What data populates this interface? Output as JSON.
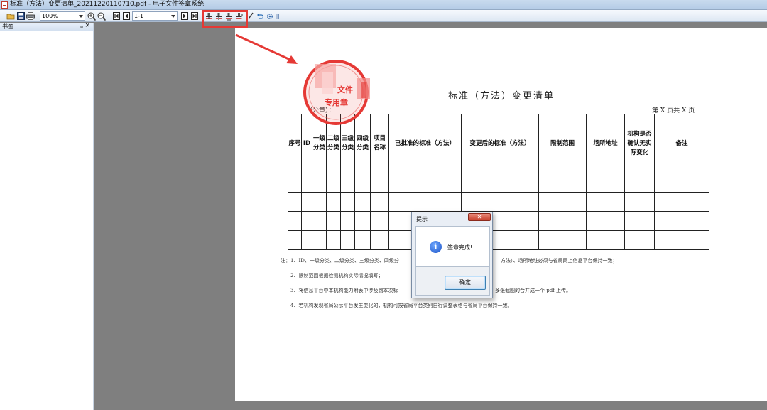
{
  "window": {
    "title": "标准（方法）变更清单_20211220110710.pdf - 电子文件签章系统"
  },
  "toolbar": {
    "icons": [
      "open-folder-icon",
      "save-icon",
      "print-icon",
      "zoom-in-icon",
      "zoom-out-icon",
      "first-page-icon",
      "prev-page-icon",
      "next-page-icon",
      "last-page-icon",
      "stamp-single-icon",
      "stamp-multi-icon",
      "stamp-riding-icon",
      "stamp-batch-icon",
      "sign-pen-icon",
      "undo-icon",
      "settings-icon"
    ],
    "zoom_value": "100%",
    "page_value": "1-1"
  },
  "sidebar": {
    "title": "书签",
    "pin_glyph": "๏",
    "close_glyph": "×"
  },
  "document": {
    "title": "标准（方法）变更清单",
    "page_number": "第 X 页共 X 页",
    "org_label": "（公章）：",
    "table": {
      "headers": [
        "序号",
        "ID",
        "一级分类",
        "二级分类",
        "三级分类",
        "四级分类",
        "项目名称",
        "已批准的标准（方法）",
        "变更后的标准（方法）",
        "限制范围",
        "场所地址",
        "机构是否确认无实际变化",
        "备注"
      ],
      "empty_rows": 4
    },
    "notes": [
      "注：1、ID、一级分类、二级分类、三级分类、四级分",
      "方法）、场所地址必须与省局网上信息平台保持一致；",
      "2、限制范围根据检测机构实际情况填写；",
      "3、将信息平台中本机构能力附表中涉及到本次标",
      "多张截图的合并成一个 pdf 上传。",
      "4、若机构发现省局公示平台发生变化的，机构可按省局平台类别自行调整表格与省局平台保持一致。"
    ],
    "stamp": {
      "text_top": "文件",
      "text_middle": "专用章",
      "color": "#e53935"
    }
  },
  "dialog": {
    "title": "提示",
    "close_label": "✕",
    "message": "签章完成!",
    "ok_label": "确定",
    "icon": "info-icon"
  },
  "annotation": {
    "highlight_color": "#e53935",
    "arrow": "arrow-from-toolbar-to-stamp"
  }
}
